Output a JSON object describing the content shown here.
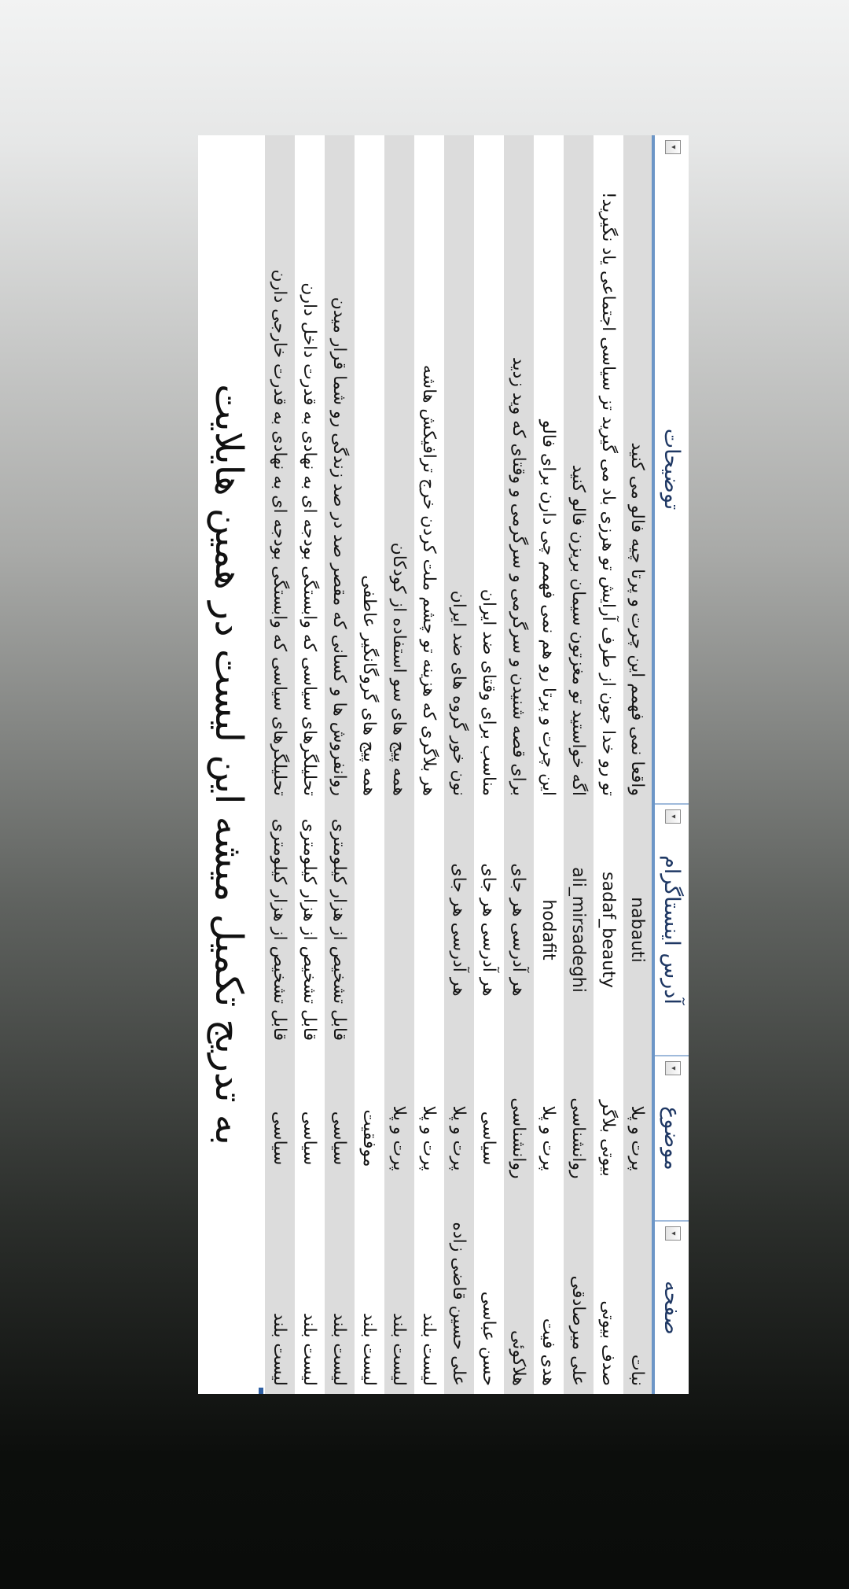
{
  "caption": "به تدریج تکمیل میشه این لیست در همین هایلایت",
  "table": {
    "headers": {
      "page": "صفحه",
      "topic": "موضوع",
      "instagram": "آدرس اینستاگرام",
      "description": "توضیحات"
    },
    "rows": [
      {
        "page": "نبات",
        "topic": "پرت و پلا",
        "instagram": "nabauti",
        "description": "واقعا نمی فهمم این چرت و پرتا چیه فالو می کنید"
      },
      {
        "page": "صدف بیوتی",
        "topic": "بیوتی بلاگر",
        "instagram": "sadaf_beauty",
        "description": "تو رو خدا جون از طرف آرایش تو هرزی باد می گیرید تز سیاسی اجتماعی یاد نگیرید!"
      },
      {
        "page": "علی میرصادقی",
        "topic": "روانشناسی",
        "instagram": "ali_mirsadeghi",
        "description": "اگه خواستید تو مغزتون سیمان بریزن فالو کنید"
      },
      {
        "page": "هدی فیت",
        "topic": "پرت و پلا",
        "instagram": "hodafit",
        "description": "این چرت و پرتا رو هم نمی فهمم چی دارن برای فالو"
      },
      {
        "page": "هلاکوئی",
        "topic": "روانشناسی",
        "instagram": "هر آدرسی هر جای",
        "description": "برای قصه شنیدن و سرگرمی و سرگرمی و وقتای که وید زدید"
      },
      {
        "page": "حسن عباسی",
        "topic": "سیاسی",
        "instagram": "هر آدرسی هر جای",
        "description": "مناسب برای وقتای ضد ایران"
      },
      {
        "page": "علی حسین قاضی زاده",
        "topic": "پرت و پلا",
        "instagram": "هر آدرسی هر جای",
        "description": "نون خور گروه های ضد ایران"
      },
      {
        "page": "لیست بلند",
        "topic": "پرت و پلا",
        "instagram": "",
        "description": "هر بلاگری که هزینه تو چشم ملت کردن خرج ترافیکش هاشه"
      },
      {
        "page": "لیست بلند",
        "topic": "پرت و پلا",
        "instagram": "",
        "description": "همه پیج های سو استفاده از کودکان"
      },
      {
        "page": "لیست بلند",
        "topic": "موفقیت",
        "instagram": "",
        "description": "همه پیج های گروگانگیر عاطفی"
      },
      {
        "page": "لیست بلند",
        "topic": "سیاسی",
        "instagram": "قابل تشخیص از هزار کیلومتری",
        "description": "روانفروش ها و کسانی که مقصر صد در صد زندگی رو شما قرار میدن"
      },
      {
        "page": "لیست بلند",
        "topic": "سیاسی",
        "instagram": "قابل تشخیص از هزار کیلومتری",
        "description": "تحلیلگرهای سیاسی که وابستگی بودجه ای به نهادی به قدرت داخل دارن"
      },
      {
        "page": "لیست بلند",
        "topic": "سیاسی",
        "instagram": "قابل تشخیص از هزار کیلومتری",
        "description": "تحلیلگرهای سیاسی که وابستگی بودجه ای به نهادی به قدرت خارجی دارن"
      }
    ]
  }
}
